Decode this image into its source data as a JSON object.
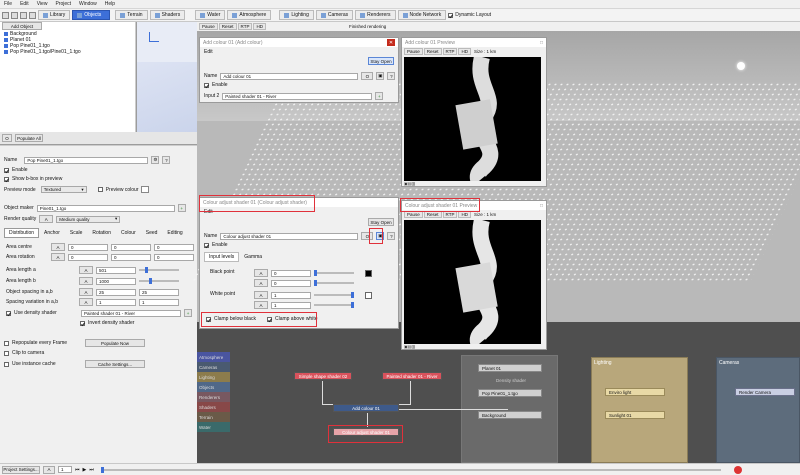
{
  "menu": [
    "File",
    "Edit",
    "View",
    "Project",
    "Window",
    "Help"
  ],
  "toolbar": {
    "tabs": [
      "Library",
      "Objects",
      "Terrain",
      "Shaders",
      "Water",
      "Atmosphere",
      "Lighting",
      "Cameras",
      "Renderers",
      "Node Network"
    ],
    "active_tab": "Objects",
    "dynamic_layout": "Dynamic Layout"
  },
  "view": {
    "buttons": [
      "Pause",
      "Reset",
      "RTP",
      "HD"
    ],
    "status": "Finished rendering"
  },
  "objects_panel": {
    "add_object": "Add Object",
    "tree": [
      "Background",
      "Planet 01",
      "Pop Pine01_1.tgo",
      "Pop Pine01_1.tgo/Pine01_1.tgo"
    ],
    "populate_all": "Populate All"
  },
  "props": {
    "name_label": "Name",
    "name_value": "Pop Pine01_1.tgo",
    "enable": "Enable",
    "show_bbox": "Show b-box in preview",
    "preview_mode_label": "Preview mode",
    "preview_mode_value": "Textured",
    "preview_colour": "Preview colour",
    "object_maker_label": "Object maker",
    "object_maker_value": "Pine01_1.tgo",
    "render_quality_label": "Render quality",
    "render_quality_value": "Medium quality",
    "tabs": [
      "Distribution",
      "Anchor",
      "Scale",
      "Rotation",
      "Colour",
      "Seed",
      "Editing"
    ],
    "area_centre": "Area centre",
    "area_rotation": "Area rotation",
    "zero": "0",
    "area_length_a": "Area length a",
    "area_length_a_value": "501",
    "area_length_b": "Area length b",
    "area_length_b_value": "1000",
    "object_spacing": "Object spacing in a,b",
    "spacing_value": "25",
    "spacing_variation": "Spacing variation in a,b",
    "spacing_variation_value": "1",
    "use_density": "Use density shader",
    "density_value": "Painted shader 01 - River",
    "invert_density": "Invert density shader",
    "repopulate": "Repopulate every Frame",
    "populate_now": "Populate Now",
    "clip_camera": "Clip to camera",
    "use_cache": "Use instance cache",
    "cache_settings": "Cache Settings..."
  },
  "status_bar": {
    "project_settings": "Project Settings...",
    "frame": "1"
  },
  "add_colour": {
    "title": "Add colour 01   (Add colour)",
    "edit": "Edit",
    "stay_open": "Stay Open",
    "name_label": "Name",
    "name_value": "Add colour 01",
    "enable": "Enable",
    "input2_label": "Input 2",
    "input2_value": "Painted shader 01 - River"
  },
  "add_colour_preview": {
    "title": "Add colour 01 Preview",
    "size": "Size : 1 km"
  },
  "colour_adjust": {
    "title": "Colour adjust shader 01   (Colour adjust shader)",
    "edit": "Edit",
    "stay_open": "Stay Open",
    "name_label": "Name",
    "name_value": "Colour adjust shader 01",
    "enable": "Enable",
    "tabs": [
      "Input levels",
      "Gamma"
    ],
    "black_point": "Black point",
    "white_point": "White point",
    "zero": "0",
    "one": "1",
    "clamp_black": "Clamp below black",
    "clamp_white": "Clamp above white"
  },
  "colour_adjust_preview": {
    "title": "Colour adjust shader 01 Preview",
    "size": "Size : 1 km"
  },
  "node_network": {
    "categories": [
      "Atmosphere",
      "Cameras",
      "Lighting",
      "Objects",
      "Renderers",
      "Shaders",
      "Terrain",
      "Water"
    ],
    "nodes": {
      "simple_shape": "Simple shape shader 02",
      "painted": "Painted shader 01 - River",
      "add_colour": "Add colour 01",
      "colour_adjust": "Colour adjust shader 01",
      "planet": "Planet 01",
      "density_shader": "Density shader",
      "pop": "Pop Pine01_1.tgo",
      "background": "Background",
      "enviro": "Enviro light",
      "sunlight": "Sunlight 01",
      "render_camera": "Render Camera"
    },
    "groups": [
      "Lighting",
      "Cameras"
    ]
  }
}
